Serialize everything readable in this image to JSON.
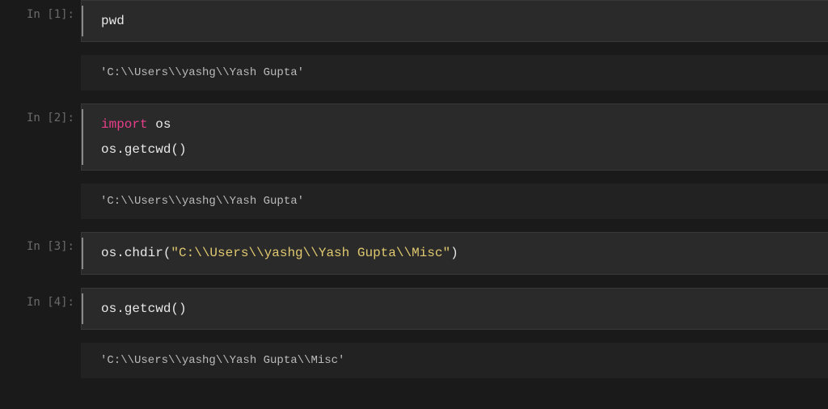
{
  "cells": [
    {
      "prompt": "In [1]:",
      "code_plain": "pwd"
    },
    {
      "output": "'C:\\\\Users\\\\yashg\\\\Yash Gupta'"
    },
    {
      "prompt": "In [2]:",
      "code_lines": {
        "kw": "import",
        "mod": "os",
        "line2": "os.getcwd()"
      }
    },
    {
      "output": "'C:\\\\Users\\\\yashg\\\\Yash Gupta'"
    },
    {
      "prompt": "In [3]:",
      "code_call": {
        "pre": "os.chdir(",
        "str": "\"C:\\\\Users\\\\yashg\\\\Yash Gupta\\\\Misc\"",
        "post": ")"
      }
    },
    {
      "prompt": "In [4]:",
      "code_plain": "os.getcwd()"
    },
    {
      "output": "'C:\\\\Users\\\\yashg\\\\Yash Gupta\\\\Misc'"
    }
  ]
}
